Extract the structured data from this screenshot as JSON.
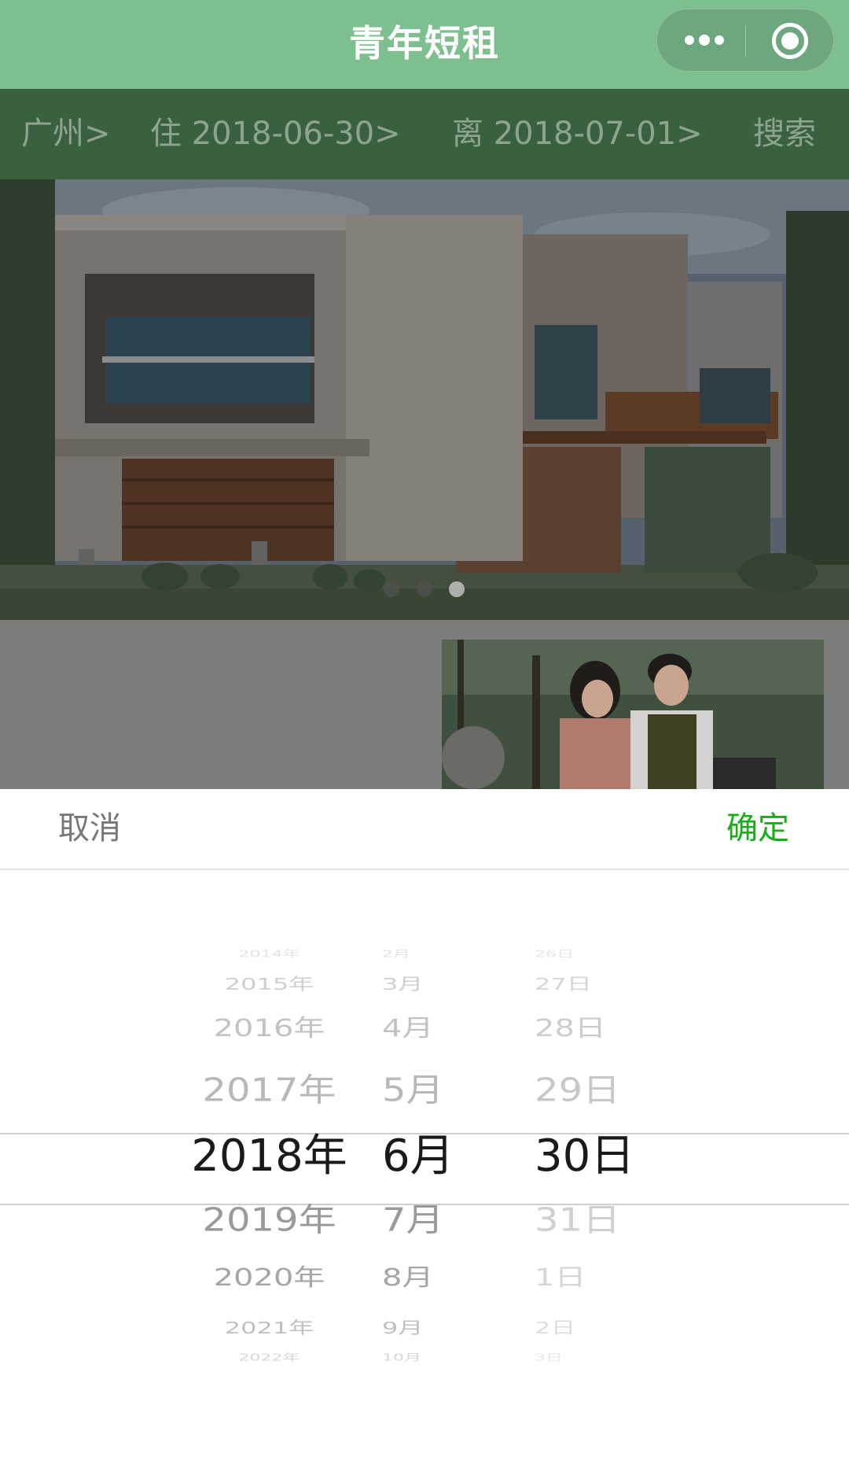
{
  "navbar": {
    "title": "青年短租",
    "capsule_more_icon": "more-dots-icon",
    "capsule_close_icon": "target-close-icon",
    "background": "#7dbf8f"
  },
  "filter": {
    "city": "广州>",
    "checkin": "住 2018-06-30>",
    "checkout": "离 2018-07-01>",
    "search": "搜索"
  },
  "banner": {
    "slides": 3,
    "active_slide": 3
  },
  "picker": {
    "cancel": "取消",
    "confirm": "确定",
    "confirm_color": "#1aad19",
    "years": [
      "2014年",
      "2015年",
      "2016年",
      "2017年",
      "2018年",
      "2019年",
      "2020年",
      "2021年",
      "2022年"
    ],
    "months": [
      "2月",
      "3月",
      "4月",
      "5月",
      "6月",
      "7月",
      "8月",
      "9月",
      "10月"
    ],
    "days": [
      "26日",
      "27日",
      "28日",
      "29日",
      "30日",
      "31日",
      "1日",
      "2日",
      "3日"
    ],
    "selected": {
      "year": "2018年",
      "month": "6月",
      "day": "30日"
    }
  }
}
